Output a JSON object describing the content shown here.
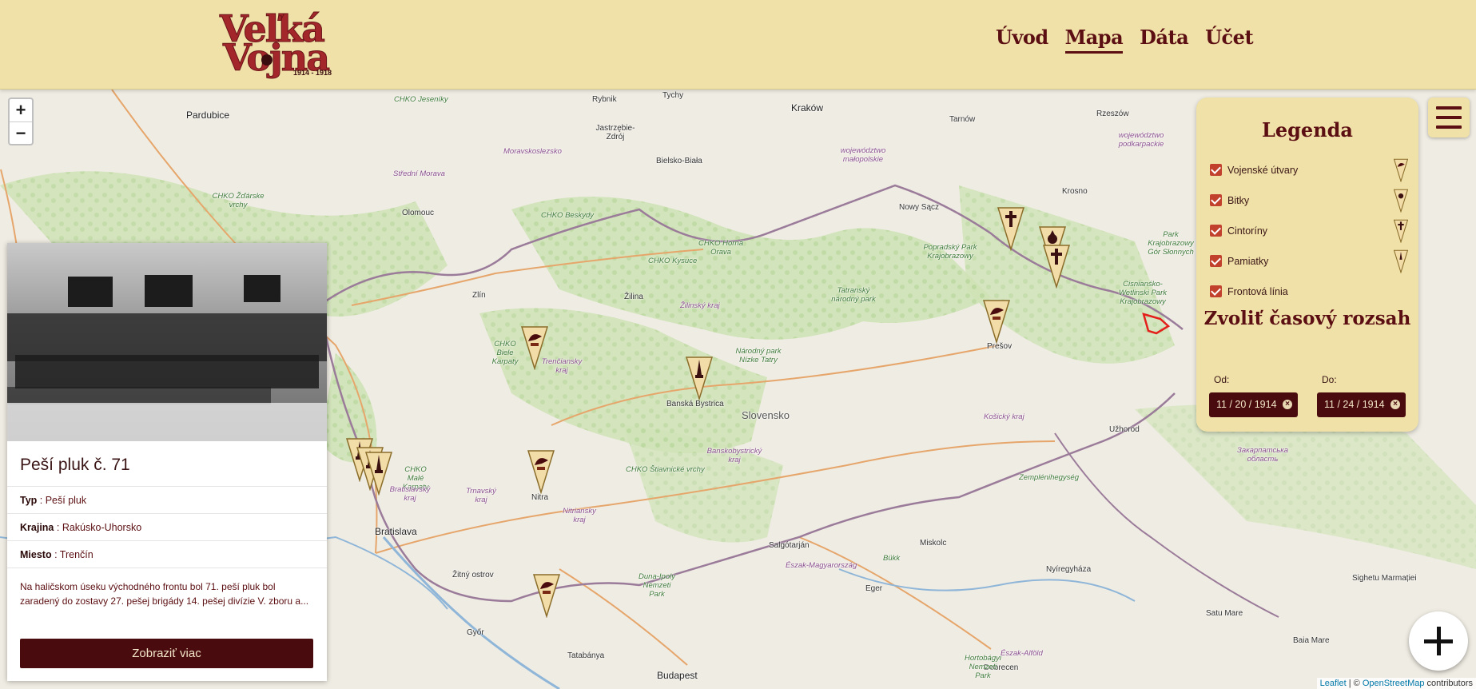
{
  "header": {
    "logo": {
      "line1": "Veľká",
      "line2": "Vojna",
      "years": "1914 - 1918"
    },
    "nav": [
      {
        "label": "Úvod",
        "active": false
      },
      {
        "label": "Mapa",
        "active": true
      },
      {
        "label": "Dáta",
        "active": false
      },
      {
        "label": "Účet",
        "active": false
      }
    ]
  },
  "map": {
    "zoom_in": "+",
    "zoom_out": "−",
    "places": [
      "Pardubice",
      "Rybnik",
      "Tychy",
      "Kraków",
      "Tarnów",
      "Rzeszów",
      "Jastrzębie-Zdrój",
      "Bielsko-Biała",
      "Olomouc",
      "Nowy Sącz",
      "Krosno",
      "Zlín",
      "Žilina",
      "Prešov",
      "Banská Bystrica",
      "Slovensko",
      "Nitra",
      "Bratislava",
      "Salgótarján",
      "Miskolc",
      "Užhorod",
      "Nyíregyháza",
      "Eger",
      "Győr",
      "Tatabánya",
      "Budapest",
      "Debrecen",
      "Sighetu Marmației",
      "Baia Mare",
      "Satu Mare",
      "Žitný ostrov"
    ],
    "parks": [
      "CHKO Jeseníky",
      "Moravskoslezsko",
      "województwo małopolskie",
      "województwo podkarpackie",
      "CHKO Žďárske vrchy",
      "Střední Morava",
      "CHKO Beskydy",
      "CHKO Kysuce",
      "CHKO Horná Orava",
      "Popradský Park Krajobrazowy",
      "Žilinský kraj",
      "Tatranský národný park",
      "Národný park Nízke Tatry",
      "Trenčiansky kraj",
      "CHKO Biele Karpaty",
      "CHKO Malé Karpaty",
      "Bratislavský kraj",
      "Trnavský kraj",
      "Nitriansky kraj",
      "CHKO Štiavnické vrchy",
      "Banskobystrický kraj",
      "Košický kraj",
      "Zemplénihegység",
      "Észak-Magyarország",
      "Bükk",
      "Duna-Ipoly Nemzeti Park",
      "Hortobágyi Nemzeti Park",
      "Észak-Alföld",
      "Закарпатська область",
      "Cisnianśko-Wetlinski Park Krajobrazowy",
      "Park Krajobrazowy Gór Słonnych"
    ]
  },
  "info": {
    "title": "Peší pluk č. 71",
    "rows": [
      {
        "key": "Typ",
        "value": "Peší pluk"
      },
      {
        "key": "Krajina",
        "value": "Rakúsko-Uhorsko"
      },
      {
        "key": "Miesto",
        "value": "Trenčín"
      }
    ],
    "description": "Na haličskom úseku východného frontu bol 71. peší pluk bol zaradený do zostavy 27. pešej brigády 14. pešej divízie V. zboru a...",
    "more_label": "Zobraziť viac"
  },
  "legend": {
    "title": "Legenda",
    "items": [
      {
        "label": "Vojenské útvary",
        "checked": true,
        "icon": "flag-marker-icon"
      },
      {
        "label": "Bitky",
        "checked": true,
        "icon": "battle-marker-icon"
      },
      {
        "label": "Cintoríny",
        "checked": true,
        "icon": "cemetery-marker-icon"
      },
      {
        "label": "Pamiatky",
        "checked": true,
        "icon": "monument-marker-icon"
      },
      {
        "label": "Frontová línia",
        "checked": true
      }
    ],
    "range_title": "Zvoliť časový rozsah",
    "from_label": "Od:",
    "from_value": "11 / 20 / 1914",
    "to_label": "Do:",
    "to_value": "11 / 24 / 1914"
  },
  "attribution": {
    "leaflet": "Leaflet",
    "sep": " | © ",
    "osm": "OpenStreetMap",
    "rest": " contributors"
  },
  "colors": {
    "header_bg": "#efe1a8",
    "accent": "#5c0f12",
    "button_dark": "#4a0b0e",
    "marker_fill": "#f2dca8"
  }
}
